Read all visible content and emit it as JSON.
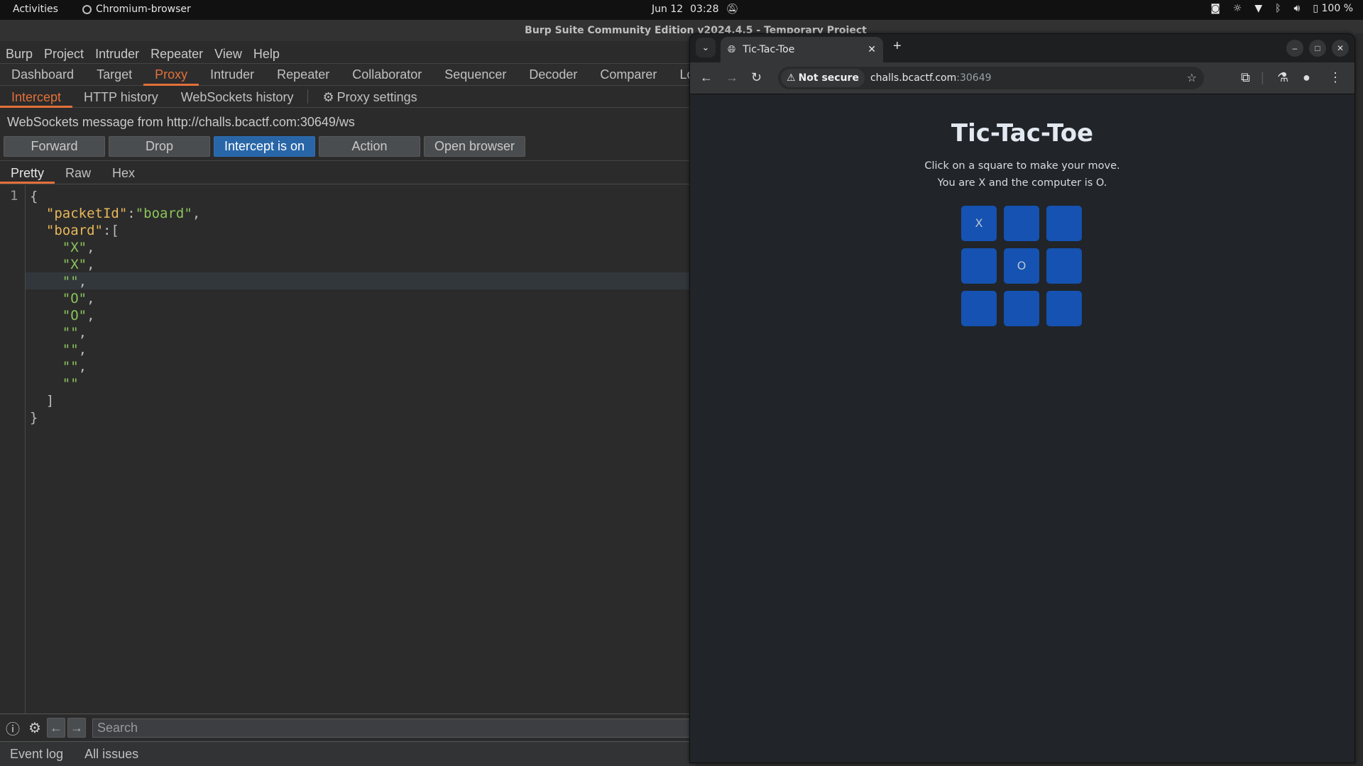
{
  "topbar": {
    "activities": "Activities",
    "app_name": "Chromium-browser",
    "date": "Jun 12",
    "time": "03:28",
    "battery": "100 %"
  },
  "burp": {
    "window_title": "Burp Suite Community Edition v2024.4.5 - Temporary Project",
    "menu": [
      "Burp",
      "Project",
      "Intruder",
      "Repeater",
      "View",
      "Help"
    ],
    "tabs": [
      "Dashboard",
      "Target",
      "Proxy",
      "Intruder",
      "Repeater",
      "Collaborator",
      "Sequencer",
      "Decoder",
      "Comparer",
      "Lo"
    ],
    "active_tab": "Proxy",
    "subtabs": [
      "Intercept",
      "HTTP history",
      "WebSockets history"
    ],
    "proxy_settings": "Proxy settings",
    "active_subtab": "Intercept",
    "message_header": "WebSockets message from http://challs.bcactf.com:30649/ws",
    "buttons": {
      "forward": "Forward",
      "drop": "Drop",
      "intercept": "Intercept is on",
      "action": "Action",
      "open_browser": "Open browser"
    },
    "view_tabs": [
      "Pretty",
      "Raw",
      "Hex"
    ],
    "active_view_tab": "Pretty",
    "editor": {
      "line_number": "1",
      "packetId_key": "\"packetId\"",
      "packetId_value": "\"board\"",
      "board_key": "\"board\"",
      "board": [
        "X",
        "X",
        "",
        "O",
        "O",
        "",
        "",
        "",
        ""
      ]
    },
    "search_placeholder": "Search",
    "bottom": [
      "Event log",
      "All issues"
    ]
  },
  "browser": {
    "tab_title": "Tic-Tac-Toe",
    "security_label": "Not secure",
    "url_host": "challs.bcactf.com",
    "url_port": ":30649",
    "page": {
      "title": "Tic-Tac-Toe",
      "line1": "Click on a square to make your move.",
      "line2": "You are X and the computer is O.",
      "cells": [
        "X",
        "",
        "",
        "",
        "O",
        "",
        "",
        "",
        ""
      ]
    }
  },
  "colors": {
    "accent": "#e2703a",
    "primary_button": "#2866a8",
    "cell": "#1552b1",
    "json_key": "#e8b85a",
    "json_string": "#8cc35c"
  }
}
